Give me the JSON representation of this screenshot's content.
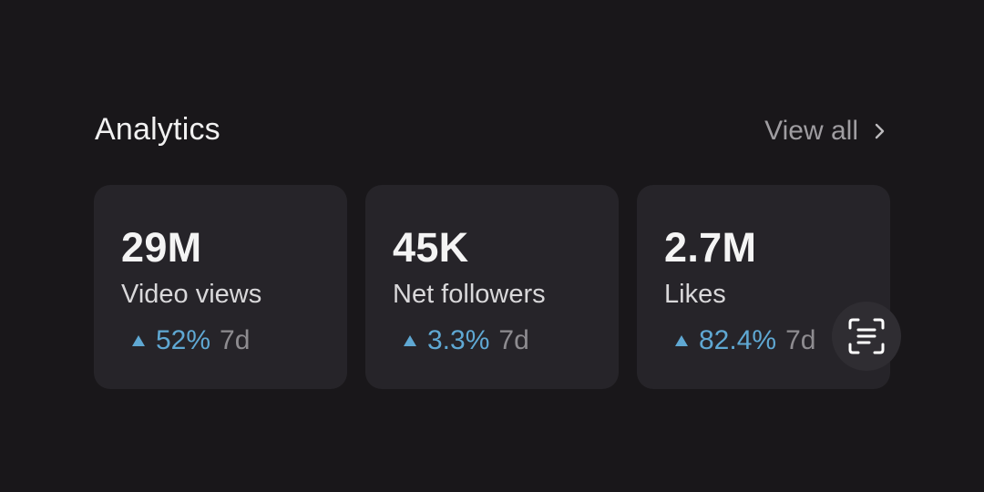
{
  "header": {
    "title": "Analytics",
    "view_all_label": "View all",
    "chevron_icon": "chevron-right-icon"
  },
  "cards": [
    {
      "value": "29M",
      "label": "Video views",
      "change": "52%",
      "period": "7d",
      "trend_icon": "triangle-up-icon"
    },
    {
      "value": "45K",
      "label": "Net followers",
      "change": "3.3%",
      "period": "7d",
      "trend_icon": "triangle-up-icon"
    },
    {
      "value": "2.7M",
      "label": "Likes",
      "change": "82.4%",
      "period": "7d",
      "trend_icon": "triangle-up-icon"
    }
  ],
  "floating_action": {
    "icon": "scan-text-icon"
  },
  "colors": {
    "background": "#19171a",
    "card": "#262429",
    "accent": "#5fa8d3",
    "muted": "#8e8c90"
  }
}
